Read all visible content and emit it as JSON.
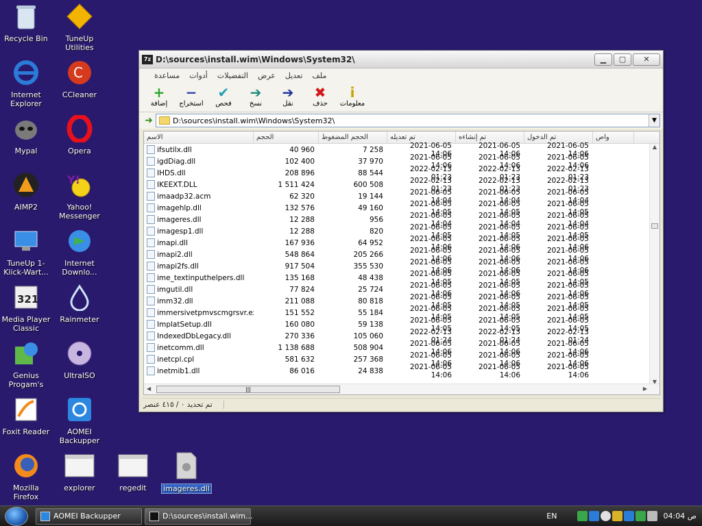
{
  "desktop": {
    "icons": [
      {
        "label": "Recycle Bin",
        "icon": "recycle-bin-icon"
      },
      {
        "label": "TuneUp Utilities",
        "icon": "tuneup-icon"
      },
      {
        "label": "Internet Explorer",
        "icon": "internet-explorer-icon"
      },
      {
        "label": "CCleaner",
        "icon": "ccleaner-icon"
      },
      {
        "label": "Mypal",
        "icon": "mypal-icon"
      },
      {
        "label": "Opera",
        "icon": "opera-icon"
      },
      {
        "label": "AIMP2",
        "icon": "aimp-icon"
      },
      {
        "label": "Yahoo! Messenger",
        "icon": "yahoo-messenger-icon"
      },
      {
        "label": "TuneUp 1-Klick-Wart...",
        "icon": "tuneup-1click-icon"
      },
      {
        "label": "Internet Downlo...",
        "icon": "internet-download-manager-icon"
      },
      {
        "label": "Media Player Classic",
        "icon": "media-player-classic-icon"
      },
      {
        "label": "Rainmeter",
        "icon": "rainmeter-icon"
      },
      {
        "label": "Genius Progam's",
        "icon": "genius-programs-icon"
      },
      {
        "label": "UltraISO",
        "icon": "ultraiso-icon"
      },
      {
        "label": "Foxit Reader",
        "icon": "foxit-reader-icon"
      },
      {
        "label": "AOMEI Backupper",
        "icon": "aomei-backupper-icon"
      },
      {
        "label": "Mozilla Firefox",
        "icon": "firefox-icon"
      },
      {
        "label": "explorer",
        "icon": "shortcut-window-icon"
      },
      {
        "label": "regedit",
        "icon": "shortcut-window-icon"
      },
      {
        "label": "imageres.dll",
        "icon": "dll-file-icon"
      }
    ]
  },
  "window": {
    "app_icon_text": "7z",
    "title": "D:\\sources\\install.wim\\Windows\\System32\\",
    "menu": [
      "ملف",
      "تعديل",
      "عرض",
      "التفضيلات",
      "أدوات",
      "مساعدة"
    ],
    "toolbar": [
      {
        "label": "إضافة",
        "icon": "+",
        "color": "#2fa52b"
      },
      {
        "label": "استخراج",
        "icon": "−",
        "color": "#2a3fa8"
      },
      {
        "label": "فحص",
        "icon": "✔",
        "color": "#1ea0b0"
      },
      {
        "label": "نسخ",
        "icon": "➔",
        "color": "#1e8a7a"
      },
      {
        "label": "نقل",
        "icon": "➔",
        "color": "#1a2f9a"
      },
      {
        "label": "حذف",
        "icon": "✖",
        "color": "#d01919"
      },
      {
        "label": "معلومات",
        "icon": "i",
        "color": "#c9a400"
      }
    ],
    "address": "D:\\sources\\install.wim\\Windows\\System32\\",
    "columns": [
      "الاسم",
      "الحجم",
      "الحجم المضغوط",
      "تم تعديله",
      "تم إنشاءه",
      "تم الدخول",
      "واص"
    ],
    "rows": [
      [
        "ifsutilx.dll",
        "40 960",
        "7 258",
        "2021-06-05 14:06",
        "2021-06-05 14:06",
        "2021-06-05 14:06"
      ],
      [
        "igdDiag.dll",
        "102 400",
        "37 970",
        "2021-06-05 14:06",
        "2021-06-05 14:06",
        "2021-06-05 14:06"
      ],
      [
        "IHDS.dll",
        "208 896",
        "88 544",
        "2022-02-13 01:23",
        "2022-02-13 01:23",
        "2022-02-13 01:23"
      ],
      [
        "IKEEXT.DLL",
        "1 511 424",
        "600 508",
        "2022-02-13 01:23",
        "2022-02-13 01:23",
        "2022-02-13 01:23"
      ],
      [
        "imaadp32.acm",
        "62 320",
        "19 144",
        "2021-06-05 14:04",
        "2021-06-05 14:04",
        "2021-06-05 14:04"
      ],
      [
        "imagehlp.dll",
        "132 576",
        "49 160",
        "2021-06-05 14:05",
        "2021-06-05 14:05",
        "2021-06-05 14:05"
      ],
      [
        "imageres.dll",
        "12 288",
        "956",
        "2021-06-05 14:04",
        "2021-06-05 14:04",
        "2021-06-05 14:04"
      ],
      [
        "imagesp1.dll",
        "12 288",
        "820",
        "2021-06-05 14:05",
        "2021-06-05 14:05",
        "2021-06-05 14:05"
      ],
      [
        "imapi.dll",
        "167 936",
        "64 952",
        "2021-06-05 14:06",
        "2021-06-05 14:06",
        "2021-06-05 14:06"
      ],
      [
        "imapi2.dll",
        "548 864",
        "205 266",
        "2021-06-05 14:06",
        "2021-06-05 14:06",
        "2021-06-05 14:06"
      ],
      [
        "imapi2fs.dll",
        "917 504",
        "355 530",
        "2021-06-05 14:06",
        "2021-06-05 14:06",
        "2021-06-05 14:06"
      ],
      [
        "ime_textinputhelpers.dll",
        "135 168",
        "48 438",
        "2021-06-05 14:05",
        "2021-06-05 14:05",
        "2021-06-05 14:05"
      ],
      [
        "imgutil.dll",
        "77 824",
        "25 724",
        "2021-06-05 14:06",
        "2021-06-05 14:06",
        "2021-06-05 14:06"
      ],
      [
        "imm32.dll",
        "211 088",
        "80 818",
        "2021-06-05 14:05",
        "2021-06-05 14:05",
        "2021-06-05 14:05"
      ],
      [
        "immersivetpmvscmgrsvr.exe",
        "151 552",
        "55 184",
        "2021-06-05 14:05",
        "2021-06-05 14:05",
        "2021-06-05 14:05"
      ],
      [
        "ImplatSetup.dll",
        "160 080",
        "59 138",
        "2021-06-05 14:05",
        "2021-06-05 14:05",
        "2021-06-05 14:05"
      ],
      [
        "IndexedDbLegacy.dll",
        "270 336",
        "105 060",
        "2022-02-13 01:24",
        "2022-02-13 01:24",
        "2022-02-13 01:24"
      ],
      [
        "inetcomm.dll",
        "1 138 688",
        "508 904",
        "2021-06-05 14:06",
        "2021-06-05 14:06",
        "2021-06-05 14:06"
      ],
      [
        "inetcpl.cpl",
        "581 632",
        "257 368",
        "2021-06-05 14:06",
        "2021-06-05 14:06",
        "2021-06-05 14:06"
      ],
      [
        "inetmib1.dll",
        "86 016",
        "24 838",
        "2021-06-05 14:06",
        "2021-06-05 14:06",
        "2021-06-05 14:06"
      ]
    ],
    "status_selected": "تم تحديد ٠ / ٤١٥ عنصر",
    "hscroll_grip": "|||"
  },
  "taskbar": {
    "tasks": [
      {
        "label": "AOMEI Backupper",
        "icon": "aomei-backupper-icon"
      },
      {
        "label": "D:\\sources\\install.wim...",
        "icon": "7zip-icon"
      }
    ],
    "lang": "EN",
    "clock": "04:04 ص"
  }
}
